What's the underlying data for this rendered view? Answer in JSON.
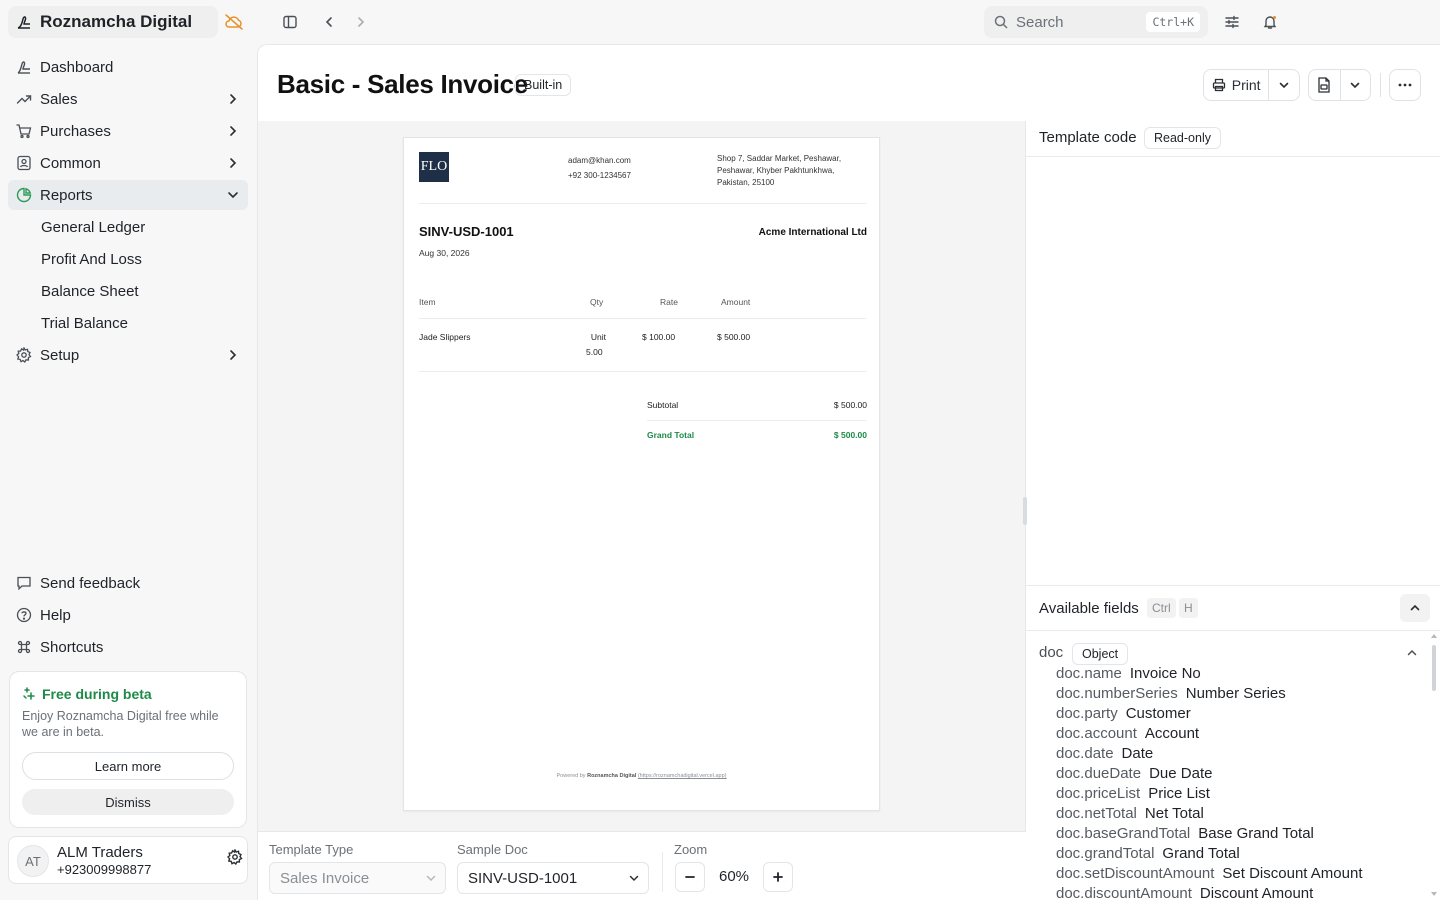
{
  "app": {
    "name": "Roznamcha Digital"
  },
  "sidebar": {
    "items": [
      {
        "label": "Dashboard",
        "icon": "dashboard-icon"
      },
      {
        "label": "Sales",
        "icon": "trending-up-icon"
      },
      {
        "label": "Purchases",
        "icon": "cart-icon"
      },
      {
        "label": "Common",
        "icon": "contacts-icon"
      },
      {
        "label": "Reports",
        "icon": "pie-chart-icon",
        "expanded": true
      },
      {
        "label": "Setup",
        "icon": "gear-icon"
      }
    ],
    "report_subitems": [
      "General Ledger",
      "Profit And Loss",
      "Balance Sheet",
      "Trial Balance"
    ],
    "bottom": [
      {
        "label": "Send feedback",
        "icon": "message-icon"
      },
      {
        "label": "Help",
        "icon": "help-icon"
      },
      {
        "label": "Shortcuts",
        "icon": "command-icon"
      }
    ],
    "beta": {
      "title": "Free during beta",
      "description": "Enjoy Roznamcha Digital free while we are in beta.",
      "learn_more": "Learn more",
      "dismiss": "Dismiss"
    },
    "user": {
      "initials": "AT",
      "name": "ALM Traders",
      "phone": "+923009998877"
    }
  },
  "topbar": {
    "search_placeholder": "Search",
    "search_shortcut": "Ctrl+K"
  },
  "page": {
    "title": "Basic - Sales Invoice",
    "badge": "Built-in",
    "print_label": "Print"
  },
  "invoice": {
    "logo_text": "FLO",
    "email": "adam@khan.com",
    "phone": "+92 300-1234567",
    "address": "Shop 7, Saddar Market, Peshawar, Peshawar, Khyber Pakhtunkhwa, Pakistan, 25100",
    "number": "SINV-USD-1001",
    "date": "Aug 30, 2026",
    "party": "Acme International Ltd",
    "columns": {
      "item": "Item",
      "qty": "Qty",
      "rate": "Rate",
      "amount": "Amount"
    },
    "rows": [
      {
        "item": "Jade Slippers",
        "unit": "Unit",
        "qty": "5.00",
        "rate": "$ 100.00",
        "amount": "$ 500.00"
      }
    ],
    "subtotal_label": "Subtotal",
    "subtotal": "$ 500.00",
    "grand_total_label": "Grand Total",
    "grand_total": "$ 500.00",
    "powered_prefix": "Powered by",
    "powered_brand": "Roznamcha Digital",
    "powered_link": "(https://roznamchadigital.vercel.app)"
  },
  "controls": {
    "template_type_label": "Template Type",
    "template_type_value": "Sales Invoice",
    "sample_doc_label": "Sample Doc",
    "sample_doc_value": "SINV-USD-1001",
    "zoom_label": "Zoom",
    "zoom_value": "60%"
  },
  "right_panel": {
    "template_code_label": "Template code",
    "read_only_badge": "Read-only",
    "available_fields_label": "Available fields",
    "shortcut_keys": [
      "Ctrl",
      "H"
    ],
    "doc_key": "doc",
    "doc_type": "Object",
    "fields": [
      {
        "key": "doc.name",
        "label": "Invoice No"
      },
      {
        "key": "doc.numberSeries",
        "label": "Number Series"
      },
      {
        "key": "doc.party",
        "label": "Customer"
      },
      {
        "key": "doc.account",
        "label": "Account"
      },
      {
        "key": "doc.date",
        "label": "Date"
      },
      {
        "key": "doc.dueDate",
        "label": "Due Date"
      },
      {
        "key": "doc.priceList",
        "label": "Price List"
      },
      {
        "key": "doc.netTotal",
        "label": "Net Total"
      },
      {
        "key": "doc.baseGrandTotal",
        "label": "Base Grand Total"
      },
      {
        "key": "doc.grandTotal",
        "label": "Grand Total"
      },
      {
        "key": "doc.setDiscountAmount",
        "label": "Set Discount Amount"
      },
      {
        "key": "doc.discountAmount",
        "label": "Discount Amount"
      }
    ]
  },
  "colors": {
    "accent": "#1e8a47",
    "sync_warning": "#e8912a"
  }
}
